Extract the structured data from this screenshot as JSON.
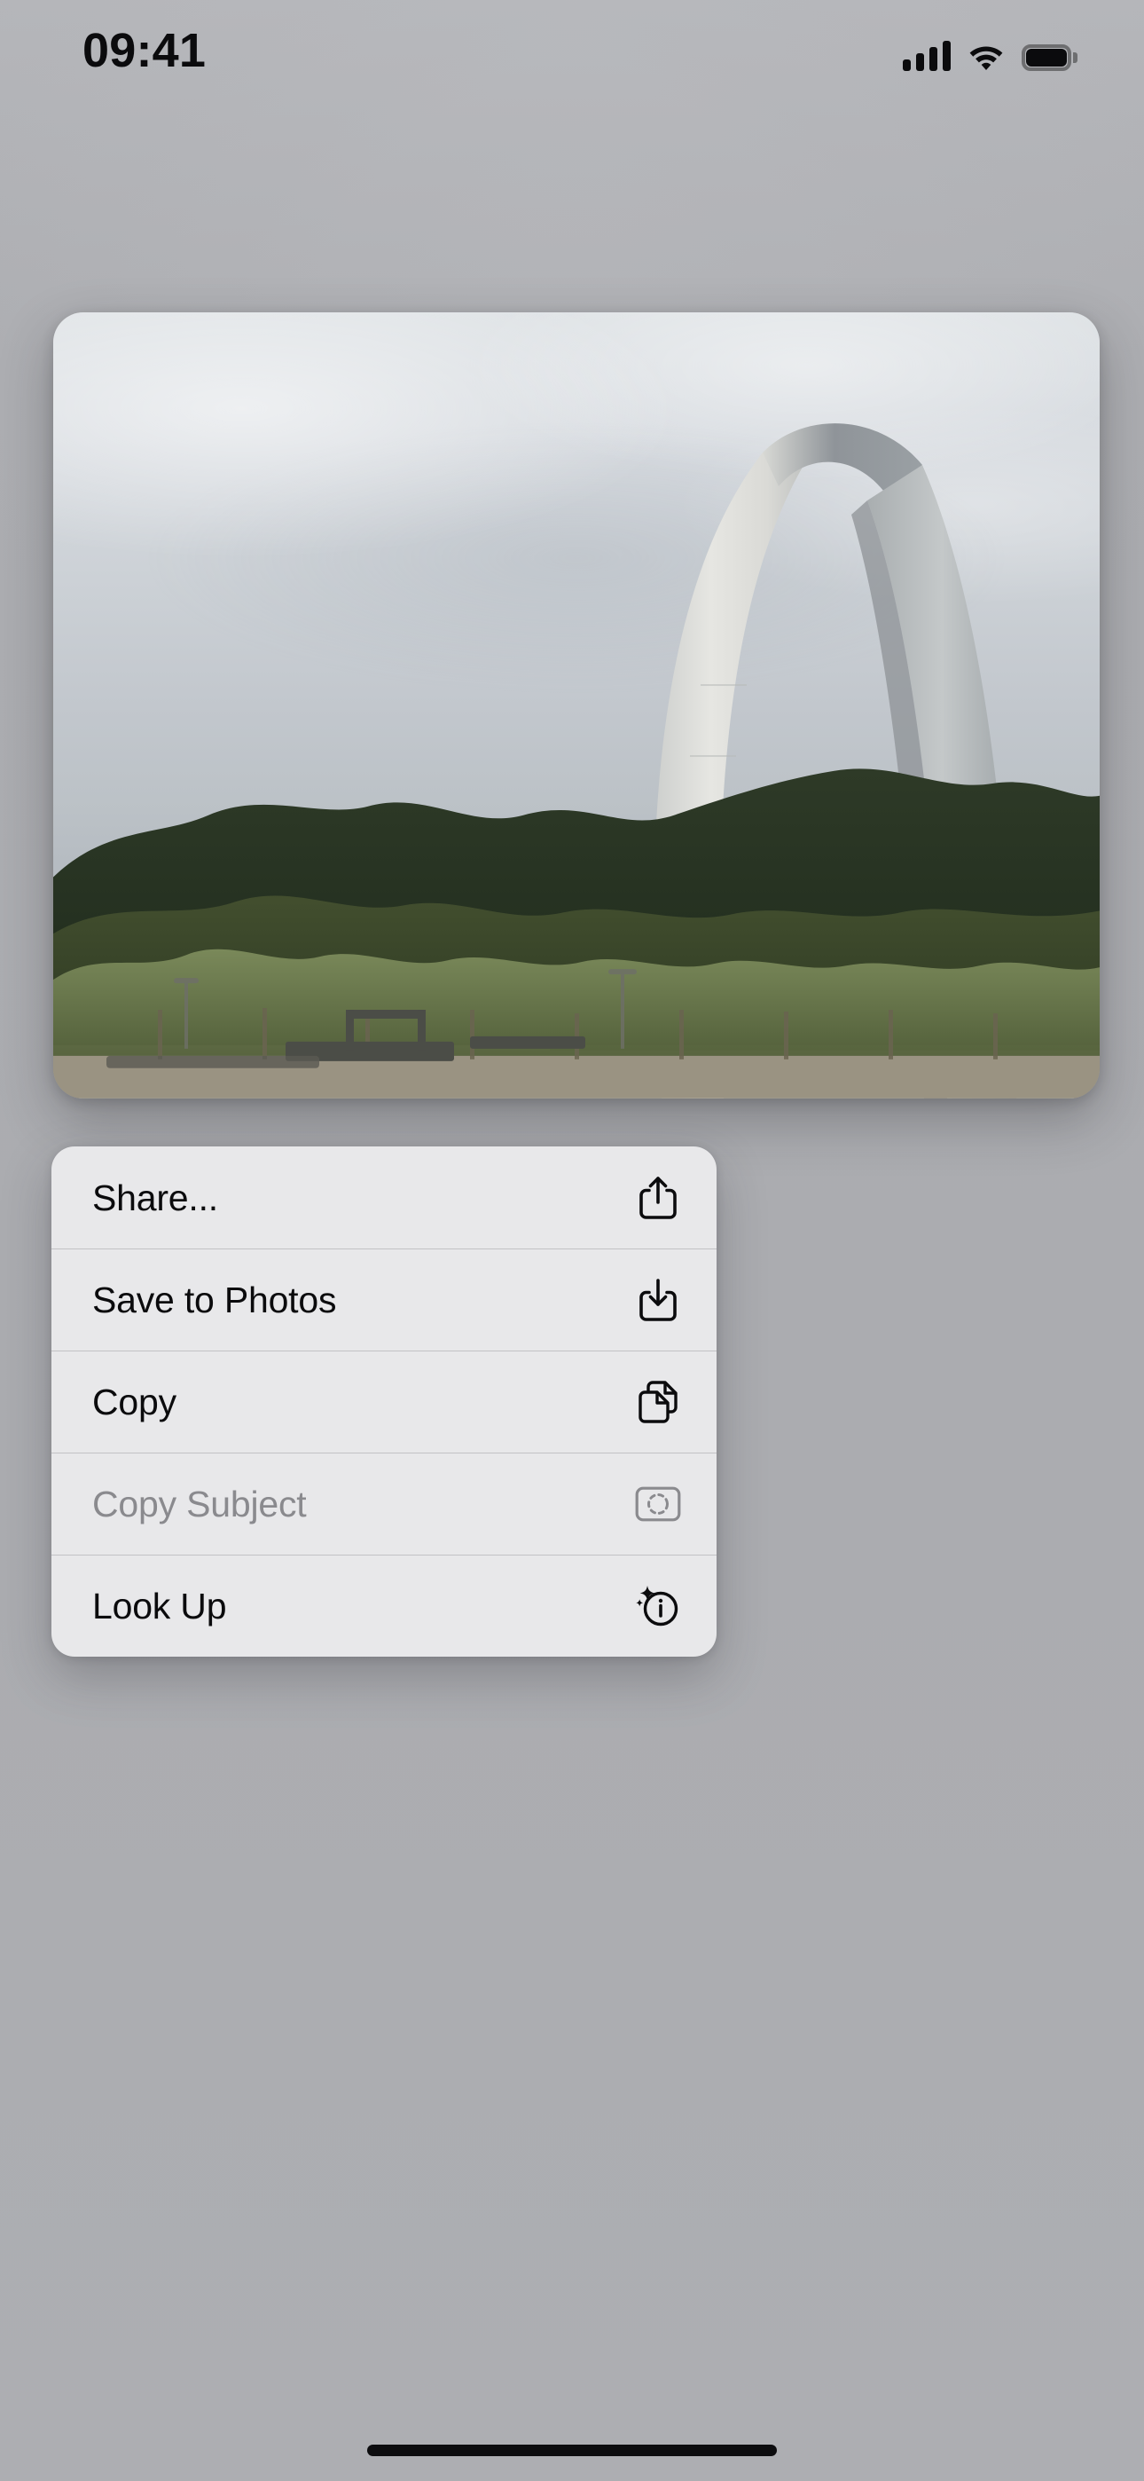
{
  "status_bar": {
    "time": "09:41",
    "cellular_icon": "cellular-bars-icon",
    "cellular_bars": 4,
    "wifi_icon": "wifi-icon",
    "battery_icon": "battery-full-icon"
  },
  "photo": {
    "name": "photo-preview",
    "alt": "Gateway Arch in St. Louis seen above a park treeline under an overcast sky"
  },
  "context_menu": {
    "items": [
      {
        "label": "Share...",
        "icon": "share-icon",
        "name": "menu-item-share",
        "disabled": false
      },
      {
        "label": "Save to Photos",
        "icon": "save-download-icon",
        "name": "menu-item-save-to-photos",
        "disabled": false
      },
      {
        "label": "Copy",
        "icon": "copy-documents-icon",
        "name": "menu-item-copy",
        "disabled": false
      },
      {
        "label": "Copy Subject",
        "icon": "subject-select-icon",
        "name": "menu-item-copy-subject",
        "disabled": true
      },
      {
        "label": "Look Up",
        "icon": "look-up-info-icon",
        "name": "menu-item-look-up",
        "disabled": false
      }
    ]
  },
  "home_indicator": {
    "name": "home-indicator"
  },
  "colors": {
    "background": "#ACADB1",
    "menu_background": "#E8E8EA",
    "label": "#0B0B0D",
    "label_disabled": "#8A8A8E",
    "divider": "rgba(60,60,67,0.22)"
  }
}
